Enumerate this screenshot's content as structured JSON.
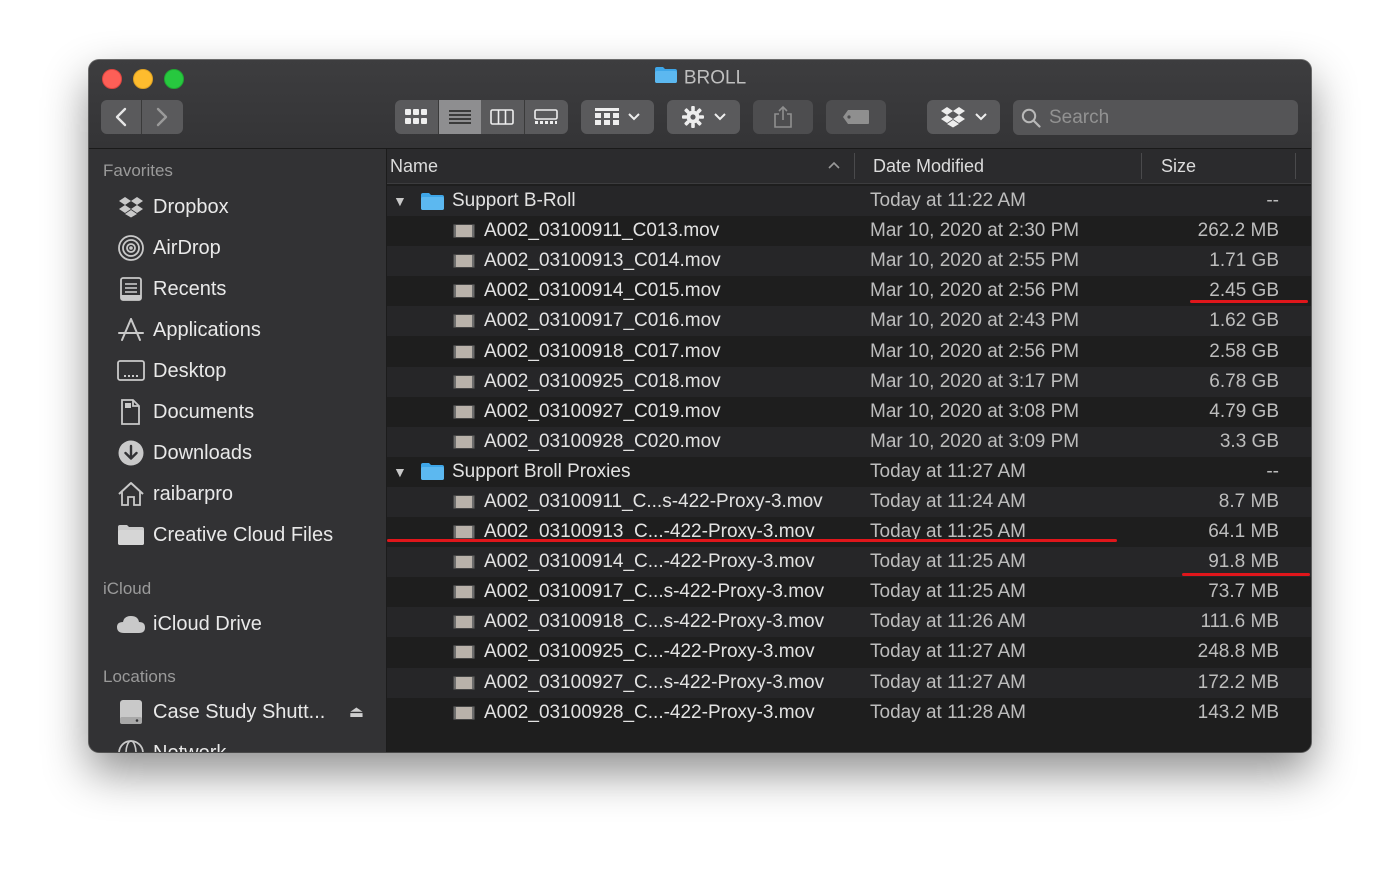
{
  "window": {
    "title": "BROLL"
  },
  "toolbar": {
    "back_label": "‹",
    "forward_label": "›",
    "search_placeholder": "Search"
  },
  "sidebar": {
    "favorites_header": "Favorites",
    "favorites": [
      {
        "label": "Dropbox",
        "icon": "dropbox-icon"
      },
      {
        "label": "AirDrop",
        "icon": "airdrop-icon"
      },
      {
        "label": "Recents",
        "icon": "recents-icon"
      },
      {
        "label": "Applications",
        "icon": "applications-icon"
      },
      {
        "label": "Desktop",
        "icon": "desktop-icon"
      },
      {
        "label": "Documents",
        "icon": "documents-icon"
      },
      {
        "label": "Downloads",
        "icon": "downloads-icon"
      },
      {
        "label": "raibarpro",
        "icon": "home-icon"
      },
      {
        "label": "Creative Cloud Files",
        "icon": "folder-icon"
      }
    ],
    "icloud_header": "iCloud",
    "icloud": [
      {
        "label": "iCloud Drive",
        "icon": "cloud-icon"
      }
    ],
    "locations_header": "Locations",
    "locations": [
      {
        "label": "Case Study Shutt...",
        "icon": "disk-icon",
        "eject": "⏏"
      },
      {
        "label": "Network",
        "icon": "network-icon"
      }
    ]
  },
  "columns": {
    "name": "Name",
    "date": "Date Modified",
    "size": "Size"
  },
  "rows": [
    {
      "type": "folder",
      "name": "Support B-Roll",
      "date": "Today at 11:22 AM",
      "size": "--"
    },
    {
      "type": "file",
      "name": "A002_03100911_C013.mov",
      "date": "Mar 10, 2020 at 2:30 PM",
      "size": "262.2 MB"
    },
    {
      "type": "file",
      "name": "A002_03100913_C014.mov",
      "date": "Mar 10, 2020 at 2:55 PM",
      "size": "1.71 GB"
    },
    {
      "type": "file",
      "name": "A002_03100914_C015.mov",
      "date": "Mar 10, 2020 at 2:56 PM",
      "size": "2.45 GB"
    },
    {
      "type": "file",
      "name": "A002_03100917_C016.mov",
      "date": "Mar 10, 2020 at 2:43 PM",
      "size": "1.62 GB"
    },
    {
      "type": "file",
      "name": "A002_03100918_C017.mov",
      "date": "Mar 10, 2020 at 2:56 PM",
      "size": "2.58 GB"
    },
    {
      "type": "file",
      "name": "A002_03100925_C018.mov",
      "date": "Mar 10, 2020 at 3:17 PM",
      "size": "6.78 GB"
    },
    {
      "type": "file",
      "name": "A002_03100927_C019.mov",
      "date": "Mar 10, 2020 at 3:08 PM",
      "size": "4.79 GB"
    },
    {
      "type": "file",
      "name": "A002_03100928_C020.mov",
      "date": "Mar 10, 2020 at 3:09 PM",
      "size": "3.3 GB"
    },
    {
      "type": "folder",
      "name": "Support Broll Proxies",
      "date": "Today at 11:27 AM",
      "size": "--"
    },
    {
      "type": "file",
      "name": "A002_03100911_C...s-422-Proxy-3.mov",
      "date": "Today at 11:24 AM",
      "size": "8.7 MB"
    },
    {
      "type": "file",
      "name": "A002_03100913_C...-422-Proxy-3.mov",
      "date": "Today at 11:25 AM",
      "size": "64.1 MB"
    },
    {
      "type": "file",
      "name": "A002_03100914_C...-422-Proxy-3.mov",
      "date": "Today at 11:25 AM",
      "size": "91.8 MB"
    },
    {
      "type": "file",
      "name": "A002_03100917_C...s-422-Proxy-3.mov",
      "date": "Today at 11:25 AM",
      "size": "73.7 MB"
    },
    {
      "type": "file",
      "name": "A002_03100918_C...s-422-Proxy-3.mov",
      "date": "Today at 11:26 AM",
      "size": "111.6 MB"
    },
    {
      "type": "file",
      "name": "A002_03100925_C...-422-Proxy-3.mov",
      "date": "Today at 11:27 AM",
      "size": "248.8 MB"
    },
    {
      "type": "file",
      "name": "A002_03100927_C...s-422-Proxy-3.mov",
      "date": "Today at 11:27 AM",
      "size": "172.2 MB"
    },
    {
      "type": "file",
      "name": "A002_03100928_C...-422-Proxy-3.mov",
      "date": "Today at 11:28 AM",
      "size": "143.2 MB"
    }
  ],
  "colors": {
    "annotation_red": "#e0161b",
    "folder_blue": "#3ea6e8",
    "window_bg": "#1e1e1e"
  }
}
